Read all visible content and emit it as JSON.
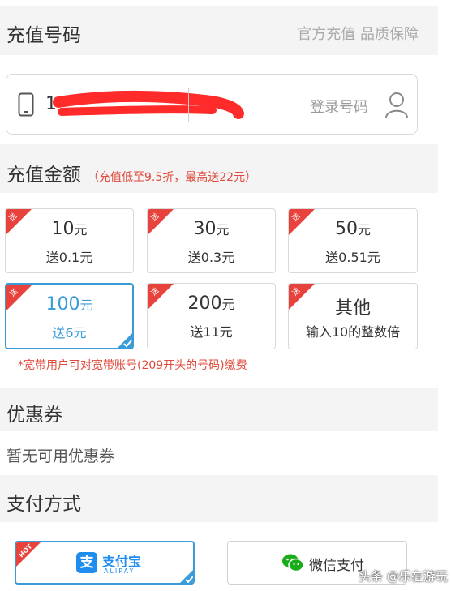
{
  "header": {
    "title": "充值号码",
    "tagline": "官方充值 品质保障"
  },
  "phone": {
    "visible_prefix": "1",
    "login_label": "登录号码"
  },
  "amount_section": {
    "title": "充值金额",
    "subtitle": "（充值低至9.5折，最高送22元）"
  },
  "cards": [
    {
      "amount": "10",
      "unit": "元",
      "bonus": "送0.1元",
      "badge": "送",
      "selected": false
    },
    {
      "amount": "30",
      "unit": "元",
      "bonus": "送0.3元",
      "badge": "送",
      "selected": false
    },
    {
      "amount": "50",
      "unit": "元",
      "bonus": "送0.51元",
      "badge": "送",
      "selected": false
    },
    {
      "amount": "100",
      "unit": "元",
      "bonus": "送6元",
      "badge": "送",
      "selected": true
    },
    {
      "amount": "200",
      "unit": "元",
      "bonus": "送11元",
      "badge": "送",
      "selected": false
    },
    {
      "amount": "其他",
      "unit": "",
      "bonus": "输入10的整数倍",
      "badge": "送",
      "selected": false
    }
  ],
  "note": "*宽带用户可对宽带账号(209开头的号码)缴费",
  "coupon": {
    "title": "优惠券",
    "empty_text": "暂无可用优惠券"
  },
  "payment": {
    "title": "支付方式",
    "alipay": {
      "badge": "HOT",
      "logo_char": "支",
      "name": "支付宝",
      "name_en": "ALIPAY",
      "selected": true
    },
    "wechat": {
      "name": "微信支付",
      "selected": false
    }
  },
  "watermark": "头条 @乐在游玩",
  "colors": {
    "accent": "#3a9bd9",
    "badge_red": "#e8423c",
    "alipay_blue": "#1f8ded",
    "wechat_green": "#1aad19"
  }
}
